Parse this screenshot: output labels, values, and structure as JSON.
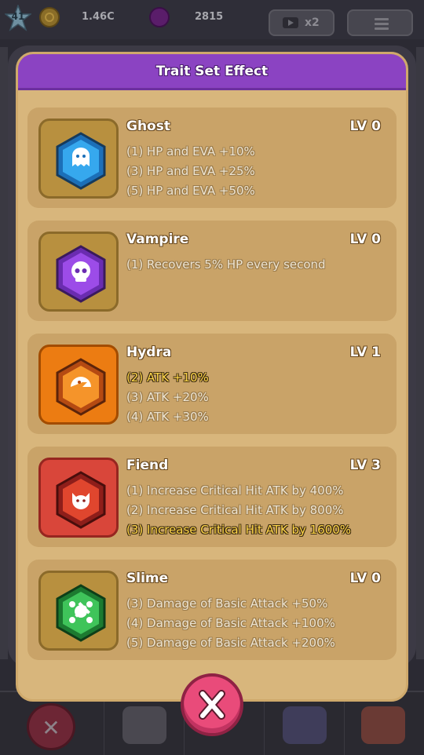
{
  "hud": {
    "player_level": "41",
    "coins": "1.46C",
    "gems": "2815",
    "ad_multiplier": "x2"
  },
  "modal": {
    "title": "Trait Set Effect",
    "traits": [
      {
        "name": "Ghost",
        "level": "LV 0",
        "icon": "ghost-icon",
        "color": "#2f9de6",
        "effects": [
          {
            "text": "(1) HP and EVA +10%",
            "active": false
          },
          {
            "text": "(3) HP and EVA +25%",
            "active": false
          },
          {
            "text": "(5) HP and EVA +50%",
            "active": false
          }
        ]
      },
      {
        "name": "Vampire",
        "level": "LV 0",
        "icon": "vampire-skull-icon",
        "color": "#8a3fe0",
        "effects": [
          {
            "text": "(1) Recovers 5% HP every second",
            "active": false
          }
        ]
      },
      {
        "name": "Hydra",
        "level": "LV 1",
        "icon": "hydra-icon",
        "color": "#f08a1c",
        "effects": [
          {
            "text": "(2) ATK +10%",
            "active": true
          },
          {
            "text": "(3) ATK +20%",
            "active": false
          },
          {
            "text": "(4) ATK +30%",
            "active": false
          }
        ]
      },
      {
        "name": "Fiend",
        "level": "LV 3",
        "icon": "fiend-icon",
        "color": "#e04a3a",
        "effects": [
          {
            "text": "(1) Increase Critical Hit ATK by 400%",
            "active": false
          },
          {
            "text": "(2) Increase Critical Hit ATK by 800%",
            "active": false
          },
          {
            "text": "(3) Increase Critical Hit ATK by 1600%",
            "active": true
          }
        ]
      },
      {
        "name": "Slime",
        "level": "LV 0",
        "icon": "slime-icon",
        "color": "#2fbe4a",
        "effects": [
          {
            "text": "(3) Damage of Basic Attack +50%",
            "active": false
          },
          {
            "text": "(4) Damage of Basic Attack +100%",
            "active": false
          },
          {
            "text": "(5) Damage of Basic Attack +200%",
            "active": false
          }
        ]
      }
    ]
  }
}
